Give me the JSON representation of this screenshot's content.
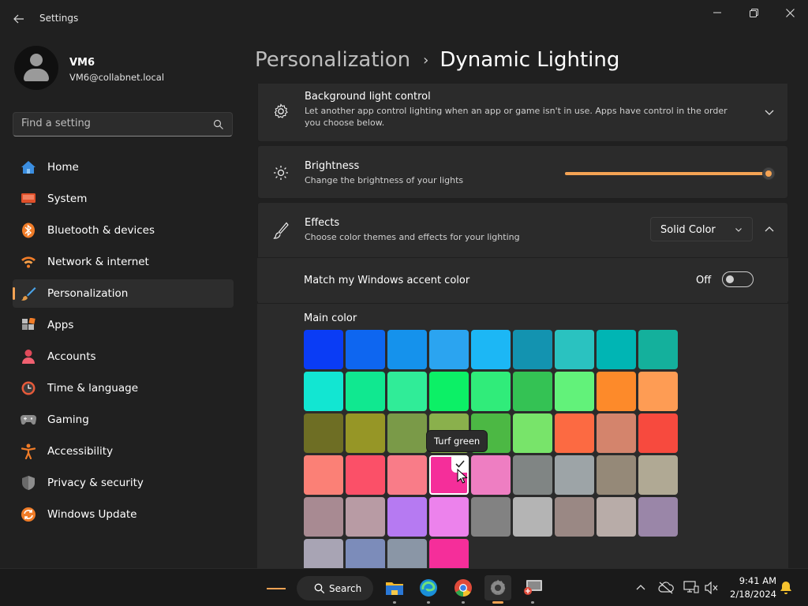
{
  "window": {
    "title": "Settings"
  },
  "profile": {
    "name": "VM6",
    "email": "VM6@collabnet.local"
  },
  "search": {
    "placeholder": "Find a setting"
  },
  "sidebar": {
    "items": [
      {
        "label": "Home",
        "icon": "home-icon",
        "selected": false
      },
      {
        "label": "System",
        "icon": "system-icon",
        "selected": false
      },
      {
        "label": "Bluetooth & devices",
        "icon": "bluetooth-icon",
        "selected": false
      },
      {
        "label": "Network & internet",
        "icon": "network-icon",
        "selected": false
      },
      {
        "label": "Personalization",
        "icon": "personalization-icon",
        "selected": true
      },
      {
        "label": "Apps",
        "icon": "apps-icon",
        "selected": false
      },
      {
        "label": "Accounts",
        "icon": "accounts-icon",
        "selected": false
      },
      {
        "label": "Time & language",
        "icon": "time-language-icon",
        "selected": false
      },
      {
        "label": "Gaming",
        "icon": "gaming-icon",
        "selected": false
      },
      {
        "label": "Accessibility",
        "icon": "accessibility-icon",
        "selected": false
      },
      {
        "label": "Privacy & security",
        "icon": "privacy-icon",
        "selected": false
      },
      {
        "label": "Windows Update",
        "icon": "windows-update-icon",
        "selected": false
      }
    ]
  },
  "breadcrumb": {
    "parent": "Personalization",
    "separator": "›",
    "current": "Dynamic Lighting"
  },
  "settings": {
    "background_control": {
      "title": "Background light control",
      "description": "Let another app control lighting when an app or game isn't in use. Apps have control in the order you choose below."
    },
    "brightness": {
      "title": "Brightness",
      "description": "Change the brightness of your lights",
      "value_percent": 100
    },
    "effects": {
      "title": "Effects",
      "description": "Choose color themes and effects for your lighting",
      "selected_effect": "Solid Color"
    },
    "accent_match": {
      "label": "Match my Windows accent color",
      "state": "Off"
    },
    "main_color": {
      "label": "Main color",
      "tooltip": "Turf green",
      "selected_index": 30,
      "colors": [
        "#0a3cf5",
        "#0e66f0",
        "#1592ec",
        "#2ba4f0",
        "#1cb7f5",
        "#1393b0",
        "#2ac2c0",
        "#00b5b4",
        "#14b09c",
        "#12e6d2",
        "#10e890",
        "#30ec98",
        "#0cf066",
        "#30ec7a",
        "#34c254",
        "#62f27a",
        "#fd8a2a",
        "#fe9c54",
        "#6e6e24",
        "#969626",
        "#7a9a48",
        "#8ab04c",
        "#4cb844",
        "#78e46a",
        "#fc6a42",
        "#d4846c",
        "#f74a3e",
        "#fb8076",
        "#fb5068",
        "#f97c88",
        "#f52e9a",
        "#ee7ec2",
        "#808584",
        "#9da4a7",
        "#958978",
        "#b0a994",
        "#a88a92",
        "#b89ba4",
        "#b67af2",
        "#ec82ec",
        "#828282",
        "#b4b4b4",
        "#9a8884",
        "#b8aca8",
        "#9a86a8",
        "#a8a4b4",
        "#7c8cba",
        "#8a96a6",
        "#f52e9a"
      ]
    }
  },
  "taskbar": {
    "search_label": "Search",
    "apps": [
      {
        "icon": "file-explorer-icon",
        "active": false
      },
      {
        "icon": "edge-icon",
        "active": false
      },
      {
        "icon": "chrome-icon",
        "active": false
      },
      {
        "icon": "settings-icon",
        "active": true
      },
      {
        "icon": "remote-desktop-icon",
        "active": false
      }
    ],
    "time": "9:41 AM",
    "date": "2/18/2024"
  },
  "theme": {
    "accent": "#f4a354",
    "background": "#202020",
    "card": "#2b2b2b"
  }
}
